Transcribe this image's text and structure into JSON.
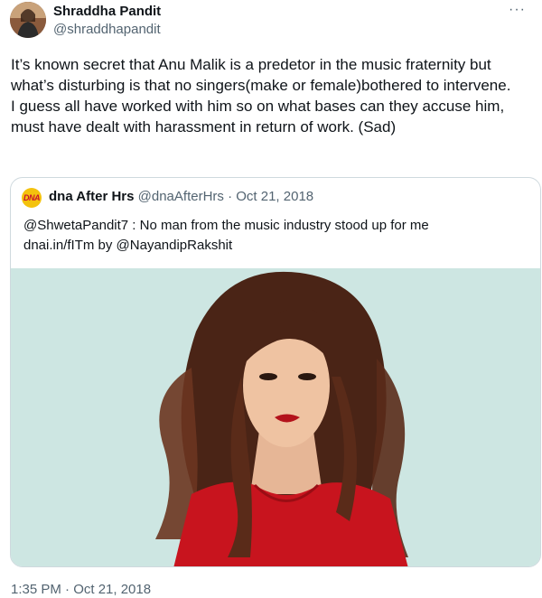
{
  "author": {
    "display_name": "Shraddha Pandit",
    "handle": "@shraddhapandit",
    "avatar_icon": "profile-photo"
  },
  "more_label": "···",
  "tweet_text": "It’s known secret that Anu Malik is a predetor in the music fraternity but what’s disturbing is that no singers(make or female)bothered to intervene.\nI guess all have worked with him so on what bases can they accuse him, must have dealt with harassment in return of work. (Sad)",
  "quoted": {
    "avatar_text": "DNA",
    "display_name": "dna After Hrs",
    "handle": "@dnaAfterHrs",
    "separator": " · ",
    "date": "Oct 21, 2018",
    "text": "@ShwetaPandit7 : No man from the music industry stood up for me\ndnai.in/fITm by @NayandipRakshit",
    "media_background": "#cde6e2"
  },
  "timestamp": "1:35 PM · Oct 21, 2018",
  "colors": {
    "text_primary": "#0f1419",
    "text_secondary": "#536471",
    "border": "#cfd9de"
  }
}
